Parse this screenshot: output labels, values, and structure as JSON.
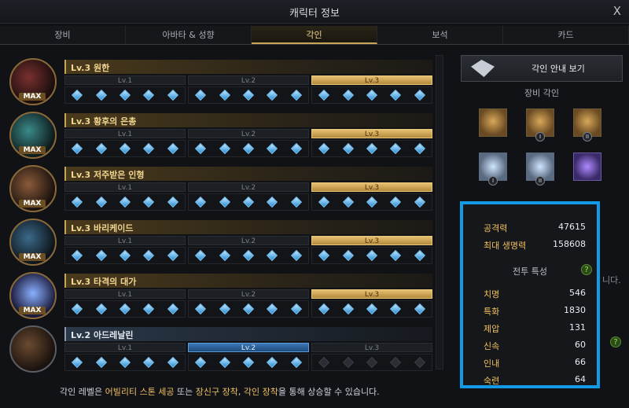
{
  "window": {
    "title": "캐릭터 정보",
    "close": "X"
  },
  "tabs": [
    "장비",
    "아바타 & 성향",
    "각인",
    "보석",
    "카드"
  ],
  "active_tab_index": 2,
  "engravings": [
    {
      "name": "Lv.3 원한",
      "levels": [
        "Lv.1",
        "Lv.2",
        "Lv.3"
      ],
      "active_level": 3,
      "max_label": "MAX",
      "gems": 15,
      "filled": 15
    },
    {
      "name": "Lv.3 황후의 은총",
      "levels": [
        "Lv.1",
        "Lv.2",
        "Lv.3"
      ],
      "active_level": 3,
      "max_label": "MAX",
      "gems": 15,
      "filled": 15
    },
    {
      "name": "Lv.3 저주받은 인형",
      "levels": [
        "Lv.1",
        "Lv.2",
        "Lv.3"
      ],
      "active_level": 3,
      "max_label": "MAX",
      "gems": 15,
      "filled": 15
    },
    {
      "name": "Lv.3 바리케이드",
      "levels": [
        "Lv.1",
        "Lv.2",
        "Lv.3"
      ],
      "active_level": 3,
      "max_label": "MAX",
      "gems": 15,
      "filled": 15
    },
    {
      "name": "Lv.3 타격의 대가",
      "levels": [
        "Lv.1",
        "Lv.2",
        "Lv.3"
      ],
      "active_level": 3,
      "max_label": "MAX",
      "gems": 15,
      "filled": 15
    },
    {
      "name": "Lv.2 아드레날린",
      "levels": [
        "Lv.1",
        "Lv.2",
        "Lv.3"
      ],
      "active_level": 2,
      "max_label": "",
      "gems": 15,
      "filled": 10
    }
  ],
  "note": {
    "p1": "각인 레벨은 ",
    "h1": "어빌리티 스톤 세공",
    "p2": " 또는 ",
    "h2": "장신구 장착",
    "p3": ", ",
    "h3": "각인 장착",
    "p4": "을 통해 상승할 수 있습니다."
  },
  "side": {
    "guide_label": "각인 안내 보기",
    "equip_title": "장비 각인",
    "equipment": [
      {
        "icon": "necklace-icon",
        "badge": ""
      },
      {
        "icon": "earring-icon",
        "badge": "I"
      },
      {
        "icon": "earring-icon",
        "badge": "II"
      },
      {
        "icon": "ring-icon",
        "badge": "I"
      },
      {
        "icon": "ring-icon",
        "badge": "II"
      },
      {
        "icon": "ability-stone-icon",
        "badge": ""
      }
    ]
  },
  "stats": {
    "attack_label": "공격력",
    "attack": "47615",
    "hp_label": "최대 생명력",
    "hp": "158608",
    "battle_title": "전투 특성",
    "crit_label": "치명",
    "crit": "546",
    "spec_label": "특화",
    "spec": "1830",
    "dom_label": "제압",
    "dom": "131",
    "swift_label": "신속",
    "swift": "60",
    "end_label": "인내",
    "end": "66",
    "exp_label": "숙련",
    "exp": "64",
    "help": "?"
  },
  "peek_text": "니다.",
  "colors": {
    "accent_gold": "#c9a55a",
    "highlight_box": "#129ae6",
    "gem_blue": "#2a8fd6"
  }
}
